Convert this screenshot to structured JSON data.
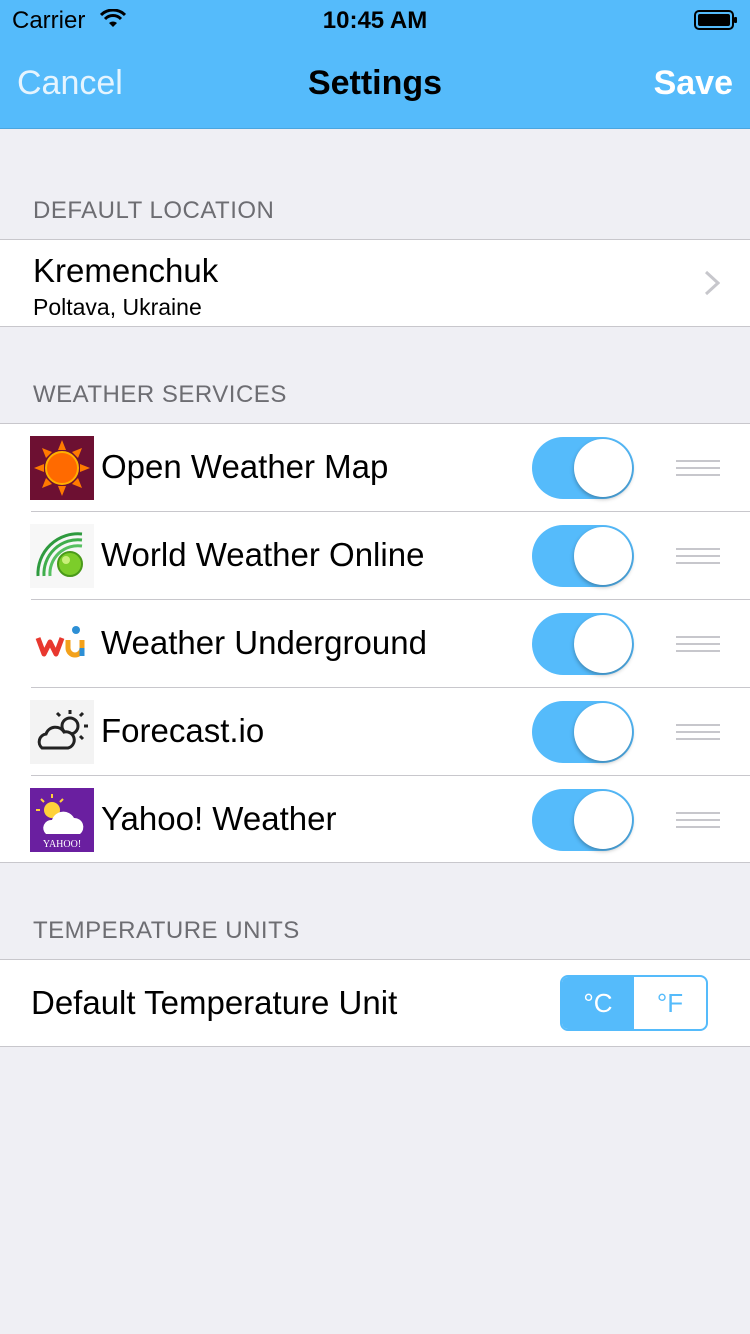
{
  "status_bar": {
    "carrier": "Carrier",
    "time": "10:45 AM"
  },
  "nav": {
    "cancel": "Cancel",
    "title": "Settings",
    "save": "Save"
  },
  "sections": {
    "location_header": "DEFAULT LOCATION",
    "services_header": "WEATHER SERVICES",
    "units_header": "TEMPERATURE UNITS"
  },
  "location": {
    "city": "Kremenchuk",
    "region": "Poltava, Ukraine"
  },
  "services": [
    {
      "name": "Open Weather Map",
      "icon": "open-weather-map-icon",
      "enabled": true
    },
    {
      "name": "World Weather Online",
      "icon": "world-weather-online-icon",
      "enabled": true
    },
    {
      "name": "Weather Underground",
      "icon": "weather-underground-icon",
      "enabled": true
    },
    {
      "name": "Forecast.io",
      "icon": "forecast-io-icon",
      "enabled": true
    },
    {
      "name": "Yahoo! Weather",
      "icon": "yahoo-weather-icon",
      "enabled": true,
      "logo_text": "YAHOO!"
    }
  ],
  "units": {
    "label": "Default Temperature Unit",
    "options": [
      "°C",
      "°F"
    ],
    "selected": "°C"
  },
  "colors": {
    "accent": "#55bbfb",
    "background": "#efeff4"
  }
}
